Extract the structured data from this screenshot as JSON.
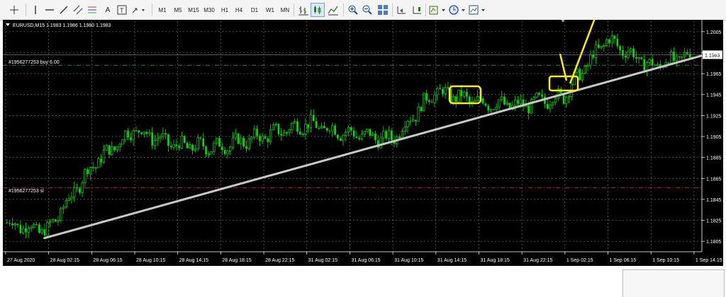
{
  "toolbar": {
    "text_tool_label": "A",
    "timeframes": [
      "M1",
      "M5",
      "M15",
      "M30",
      "H1",
      "H4",
      "D1",
      "W1",
      "MN"
    ]
  },
  "chart": {
    "header": "EURUSD,M15  1.1983 1.1986 1.1980 1.1983",
    "price_label": "1.1983",
    "buy_line_label": "#1956277253 buy 6.00",
    "sl_line_label": "#1956277253 sl",
    "y_ticks": [
      "1.2005",
      "1.1985",
      "1.1965",
      "1.1945",
      "1.1925",
      "1.1905",
      "1.1885",
      "1.1865",
      "1.1845",
      "1.1825",
      "1.1805"
    ],
    "x_ticks": [
      "27 Aug 2020",
      "28 Aug 02:15",
      "28 Aug 06:15",
      "28 Aug 10:15",
      "28 Aug 14:15",
      "28 Aug 18:15",
      "28 Aug 22:15",
      "31 Aug 02:15",
      "31 Aug 06:15",
      "31 Aug 10:15",
      "31 Aug 14:15",
      "31 Aug 18:15",
      "31 Aug 22:15",
      "1 Sep 02:15",
      "1 Sep 06:15",
      "1 Sep 10:15",
      "1 Sep 14:15"
    ],
    "colors": {
      "background": "#000000",
      "bull": "#00e000",
      "bear": "#00e000",
      "grid": "#6a6a6a",
      "buy_line": "#1e8a2e",
      "sl_line": "#c02020",
      "trend_line": "#c8c8c8",
      "annotation": "#ffee00"
    }
  },
  "chart_data": {
    "type": "candlestick",
    "symbol": "EURUSD",
    "timeframe": "M15",
    "ylim": [
      1.1795,
      1.2015
    ],
    "anchors": [
      [
        "27 Aug 2020",
        1.1823
      ],
      [
        "28 Aug 02:15",
        1.1815
      ],
      [
        "28 Aug 06:15",
        1.1875
      ],
      [
        "28 Aug 10:15",
        1.1912
      ],
      [
        "28 Aug 14:15",
        1.1896
      ],
      [
        "28 Aug 18:15",
        1.1895
      ],
      [
        "28 Aug 22:15",
        1.1905
      ],
      [
        "31 Aug 02:15",
        1.1917
      ],
      [
        "31 Aug 06:15",
        1.1908
      ],
      [
        "31 Aug 10:15",
        1.1902
      ],
      [
        "31 Aug 14:15",
        1.1948
      ],
      [
        "31 Aug 18:15",
        1.1938
      ],
      [
        "31 Aug 22:15",
        1.1934
      ],
      [
        "1 Sep 02:15",
        1.1944
      ],
      [
        "1 Sep 06:15",
        1.1998
      ],
      [
        "1 Sep 10:15",
        1.1972
      ],
      [
        "1 Sep 14:15",
        1.1983
      ]
    ],
    "last_price": 1.1983,
    "horizontal_lines": [
      {
        "label": "#1956277253 buy 6.00",
        "price": 1.1973
      },
      {
        "label": "#1956277253 sl",
        "price": 1.1856
      }
    ],
    "trendline": {
      "from": [
        "28 Aug 02:15",
        1.1808
      ],
      "to": [
        "1 Sep 22:15",
        1.1982
      ]
    },
    "grid": true
  }
}
